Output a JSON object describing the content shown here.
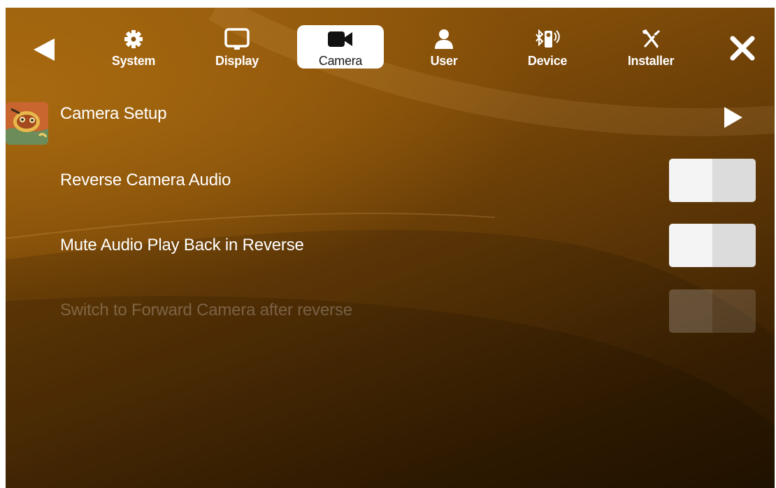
{
  "nav": {
    "back_icon": "back-arrow-icon",
    "close_icon": "close-icon",
    "tabs": [
      {
        "label": "System",
        "icon": "gear-icon",
        "active": false
      },
      {
        "label": "Display",
        "icon": "monitor-icon",
        "active": false
      },
      {
        "label": "Camera",
        "icon": "video-camera-icon",
        "active": true
      },
      {
        "label": "User",
        "icon": "user-icon",
        "active": false
      },
      {
        "label": "Device",
        "icon": "bluetooth-device-icon",
        "active": false
      },
      {
        "label": "Installer",
        "icon": "tools-icon",
        "active": false
      }
    ]
  },
  "settings": {
    "camera_setup": {
      "label": "Camera Setup",
      "icon": "app-icon",
      "action_icon": "play-arrow-icon"
    },
    "reverse_camera_audio": {
      "label": "Reverse Camera Audio",
      "enabled": true,
      "on": false
    },
    "mute_audio_playback": {
      "label": "Mute Audio Play Back in Reverse",
      "enabled": true,
      "on": false
    },
    "switch_forward_camera": {
      "label": "Switch to Forward Camera after reverse",
      "enabled": false,
      "on": false
    }
  },
  "colors": {
    "background_top": "#9a5e0e",
    "background_bottom": "#2a1702",
    "active_tab": "#ffffff",
    "toggle_track": "#dcdcdc",
    "toggle_knob": "#f4f4f4"
  }
}
